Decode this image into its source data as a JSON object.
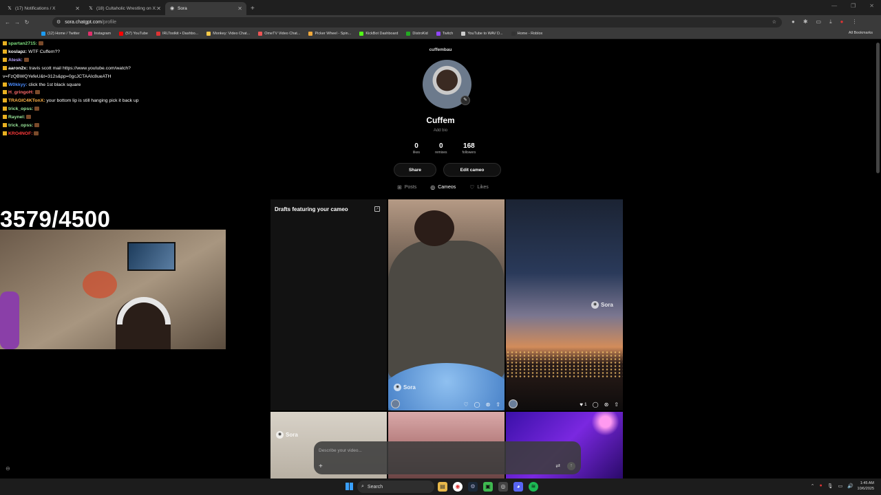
{
  "browser": {
    "tabs": [
      {
        "icon": "x-icon",
        "title": "(17) Notifications / X",
        "active": false
      },
      {
        "icon": "x-icon",
        "title": "(18) Cultaholic Wrestling on X:",
        "active": false
      },
      {
        "icon": "sora-icon",
        "title": "Sora",
        "active": true
      }
    ],
    "url_host": "sora.chatgpt.com",
    "url_path": "/profile",
    "bookmarks": [
      {
        "label": "(12) Home / Twitter",
        "color": "#1d9bf0"
      },
      {
        "label": "Instagram",
        "color": "#e1306c"
      },
      {
        "label": "(57) YouTube",
        "color": "#ff0000"
      },
      {
        "label": "IRLToolkit • Dashbo...",
        "color": "#d33"
      },
      {
        "label": "Monkey: Video Chat...",
        "color": "#f7c948"
      },
      {
        "label": "OmeTV Video Chat...",
        "color": "#e55"
      },
      {
        "label": "Picker Wheel - Spin...",
        "color": "#f2a93b"
      },
      {
        "label": "KickBot Dashboard",
        "color": "#53fc18"
      },
      {
        "label": "DistroKid",
        "color": "#2a2"
      },
      {
        "label": "Twitch",
        "color": "#9146ff"
      },
      {
        "label": "YouTube to WAV D...",
        "color": "#ccc"
      },
      {
        "label": "Home - Roblox",
        "color": "#333"
      }
    ],
    "all_bookmarks": "All Bookmarks"
  },
  "chat": [
    {
      "user": "spartan2715:",
      "color": "#7ee07e",
      "msg": ""
    },
    {
      "user": "koslapz:",
      "color": "#ffffff",
      "msg": "WTF Cuffem??"
    },
    {
      "user": "Atesk:",
      "color": "#b9a3ff",
      "msg": ""
    },
    {
      "user": "aaron2x:",
      "color": "#ffffff",
      "msg": "travis scott mail https://www.youtube.com/watch?"
    },
    {
      "user": "",
      "color": "#ffffff",
      "msg": "v=FzQBWQYefeU&t=312s&pp=0gcJCTAAIc8ueATH"
    },
    {
      "user": "W0kkyy:",
      "color": "#4a8cff",
      "msg": "click the 1st black square"
    },
    {
      "user": "H_gringoH:",
      "color": "#ff6a6a",
      "msg": ""
    },
    {
      "user": "TRAGIC4KTonX:",
      "color": "#ffb347",
      "msg": "your bottom lip is still hanging pick it back up"
    },
    {
      "user": "trick_opss:",
      "color": "#9be89b",
      "msg": ""
    },
    {
      "user": "Raynel:",
      "color": "#9be89b",
      "msg": ""
    },
    {
      "user": "trick_opss:",
      "color": "#9be89b",
      "msg": ""
    },
    {
      "user": "KRO4NOF:",
      "color": "#ff3a3a",
      "msg": ""
    }
  ],
  "counter": "3579/4500",
  "profile": {
    "handle": "cuffembau",
    "display_name": "Cuffem",
    "bio_placeholder": "Add bio",
    "stats": [
      {
        "value": "0",
        "label": "likes"
      },
      {
        "value": "0",
        "label": "remixes"
      },
      {
        "value": "168",
        "label": "followers"
      }
    ],
    "share_label": "Share",
    "edit_cameo_label": "Edit cameo",
    "tabs": [
      {
        "label": "Posts",
        "icon": "posts-icon",
        "active": false
      },
      {
        "label": "Cameos",
        "icon": "cameo-icon",
        "active": true
      },
      {
        "label": "Likes",
        "icon": "heart-icon",
        "active": false
      }
    ],
    "drafts_title": "Drafts featuring your cameo",
    "watermark": "Sora",
    "video2_likes": "1",
    "composer_placeholder": "Describe your video..."
  },
  "taskbar": {
    "search_label": "Search",
    "time": "1:45 AM",
    "date": "10/6/2025"
  }
}
